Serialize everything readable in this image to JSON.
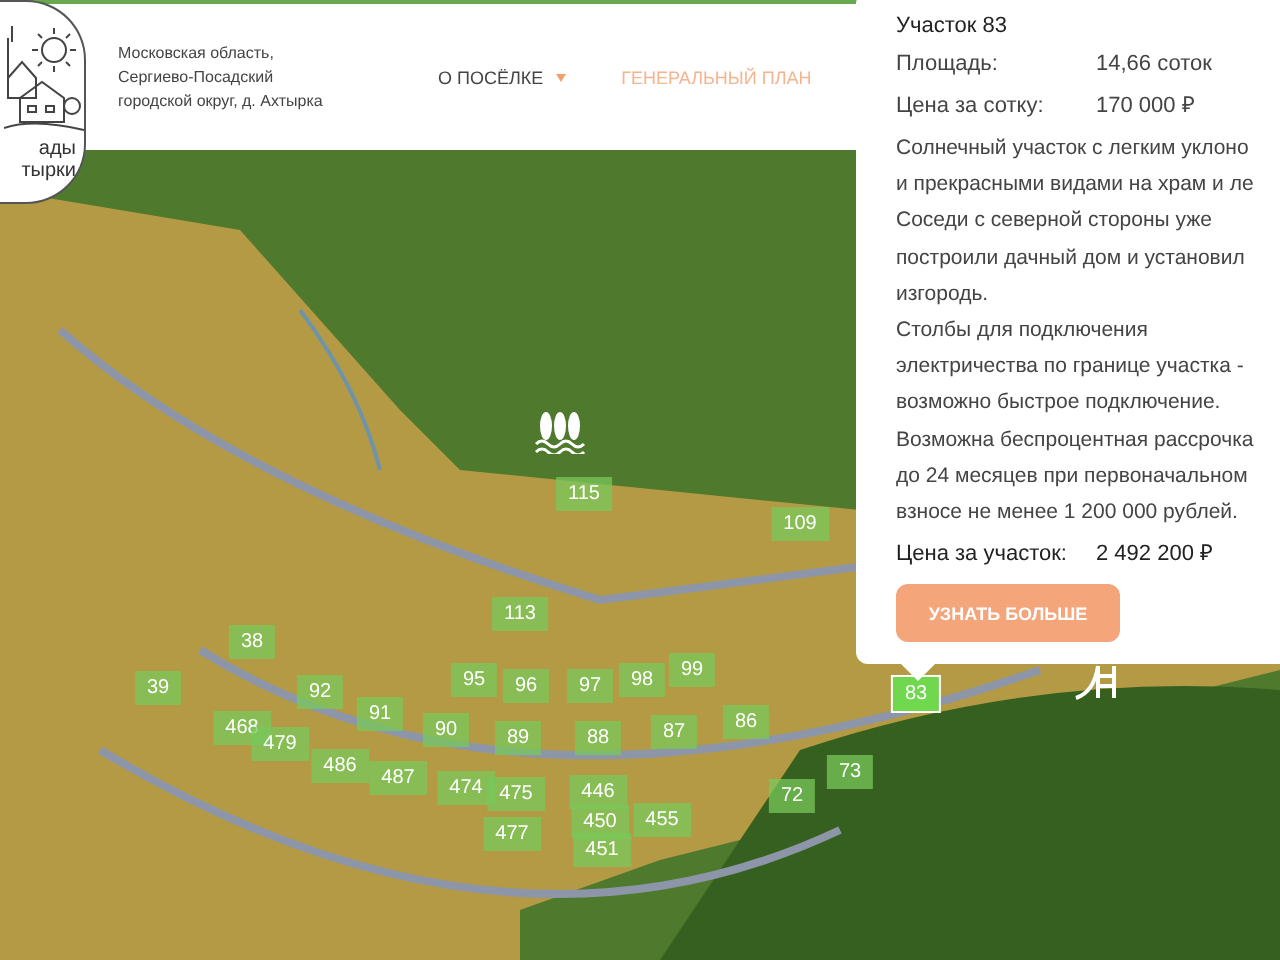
{
  "logo": {
    "lines": [
      "ады",
      "тырки"
    ]
  },
  "header": {
    "address": "Московская область,\nСергиево-Посадский\nгородской округ, д.  Ахтырка",
    "nav": [
      {
        "label": "О ПОСЁЛКЕ",
        "has_dropdown": true,
        "selected": false
      },
      {
        "label": "ГЕНЕРАЛЬНЫЙ ПЛАН",
        "has_dropdown": false,
        "selected": true
      }
    ]
  },
  "map": {
    "plots": [
      {
        "number": "115",
        "selected": false
      },
      {
        "number": "109",
        "selected": false
      },
      {
        "number": "113",
        "selected": false
      },
      {
        "number": "38",
        "selected": false
      },
      {
        "number": "39",
        "selected": false
      },
      {
        "number": "92",
        "selected": false
      },
      {
        "number": "95",
        "selected": false
      },
      {
        "number": "96",
        "selected": false
      },
      {
        "number": "97",
        "selected": false
      },
      {
        "number": "98",
        "selected": false
      },
      {
        "number": "99",
        "selected": false
      },
      {
        "number": "83",
        "selected": true
      },
      {
        "number": "468",
        "selected": false
      },
      {
        "number": "479",
        "selected": false
      },
      {
        "number": "91",
        "selected": false
      },
      {
        "number": "90",
        "selected": false
      },
      {
        "number": "89",
        "selected": false
      },
      {
        "number": "88",
        "selected": false
      },
      {
        "number": "87",
        "selected": false
      },
      {
        "number": "86",
        "selected": false
      },
      {
        "number": "486",
        "selected": false
      },
      {
        "number": "487",
        "selected": false
      },
      {
        "number": "474",
        "selected": false
      },
      {
        "number": "475",
        "selected": false
      },
      {
        "number": "446",
        "selected": false
      },
      {
        "number": "72",
        "selected": false
      },
      {
        "number": "73",
        "selected": false
      },
      {
        "number": "477",
        "selected": false
      },
      {
        "number": "450",
        "selected": false
      },
      {
        "number": "455",
        "selected": false
      },
      {
        "number": "451",
        "selected": false
      }
    ]
  },
  "popup": {
    "title": "Участок 83",
    "specs": [
      {
        "label": "Площадь:",
        "value": "14,66 соток"
      },
      {
        "label": "Цена за сотку:",
        "value": "170 000 ₽"
      }
    ],
    "description": [
      "Солнечный участок с легким уклоно\nи прекрасными видами на храм и ле\nСоседи с северной стороны уже\nпостроили дачный дом и установил\nизгородь.",
      "Столбы для подключения\nэлектричества по границе участка -\nвозможно быстрое подключение.\nВозможна беспроцентная рассрочка\nдо 24 месяцев при первоначальном\nвзносе не менее 1 200 000 рублей."
    ],
    "price": {
      "label": "Цена за участок:",
      "value": "2 492 200 ₽"
    },
    "button": "УЗНАТЬ БОЛЬШЕ"
  }
}
